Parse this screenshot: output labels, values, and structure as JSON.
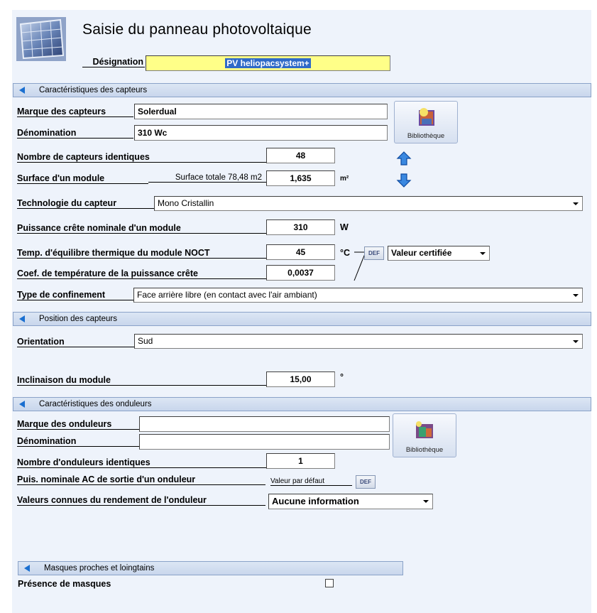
{
  "header": {
    "title": "Saisie du panneau photovoltaique",
    "designation_label": "Désignation",
    "designation_value": "PV heliopacsystem+"
  },
  "sections": {
    "capteurs": "Caractéristiques des capteurs",
    "position": "Position des capteurs",
    "onduleurs": "Caractéristiques des onduleurs",
    "masques": "Masques proches et loingtains"
  },
  "capteurs": {
    "marque_label": "Marque des capteurs",
    "marque_value": "Solerdual",
    "denomination_label": "Dénomination",
    "denomination_value": "310 Wc",
    "library_label": "Bibliothèque",
    "nombre_label": "Nombre de capteurs identiques",
    "nombre_value": "48",
    "surface_label": "Surface d'un module",
    "surface_totale": "Surface totale 78,48 m2",
    "surface_value": "1,635",
    "surface_unit": "m²",
    "techno_label": "Technologie du capteur",
    "techno_value": "Mono Cristallin",
    "puissance_label": "Puissance crête nominale d'un module",
    "puissance_value": "310",
    "puissance_unit": "W",
    "noct_label": "Temp. d'équilibre thermique du module NOCT",
    "noct_value": "45",
    "noct_unit": "°C",
    "def_label": "DEF",
    "valeur_select": "Valeur certifiée",
    "coef_label": "Coef. de température de la puissance crête",
    "coef_value": "0,0037",
    "confinement_label": "Type de confinement",
    "confinement_value": "Face arrière libre (en contact avec l'air ambiant)"
  },
  "position": {
    "orientation_label": "Orientation",
    "orientation_value": "Sud",
    "inclinaison_label": "Inclinaison du module",
    "inclinaison_value": "15,00",
    "inclinaison_unit": "°"
  },
  "onduleurs": {
    "marque_label": "Marque des onduleurs",
    "marque_value": "",
    "denomination_label": "Dénomination",
    "denomination_value": "",
    "library_label": "Bibliothèque",
    "nombre_label": "Nombre d'onduleurs identiques",
    "nombre_value": "1",
    "puis_label": "Puis. nominale AC de sortie d'un onduleur",
    "puis_default": "Valeur par défaut",
    "def_label": "DEF",
    "rendement_label": "Valeurs connues du rendement  de l'onduleur",
    "rendement_value": "Aucune information"
  },
  "masques": {
    "presence_label": "Présence de masques",
    "presence_checked": false
  }
}
